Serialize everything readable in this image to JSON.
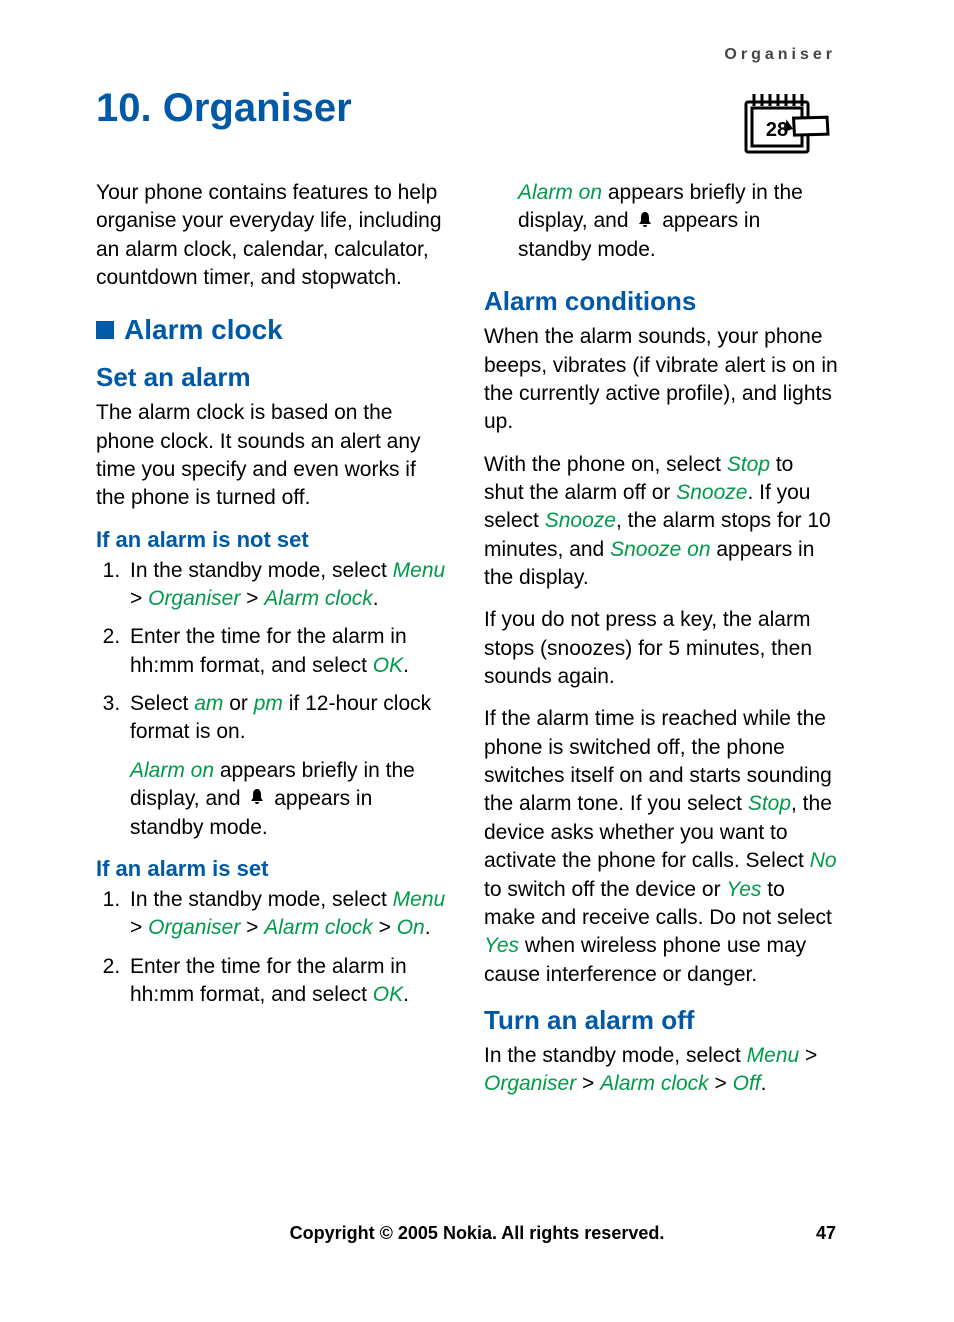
{
  "running_head": "Organiser",
  "chapter_title": "10. Organiser",
  "intro": "Your phone contains features to help organise your everyday life, including an alarm clock, calendar, calculator, countdown timer, and stopwatch.",
  "h2_alarm_clock": "Alarm clock",
  "h3_set_alarm": "Set an alarm",
  "set_alarm_p": "The alarm clock is based on the phone clock. It sounds an alert any time you specify and even works if the phone is turned off.",
  "h4_not_set": "If an alarm is not set",
  "not_set_step1_a": "In the standby mode, select ",
  "term_menu": "Menu",
  "gt": " > ",
  "term_organiser": "Organiser",
  "term_alarm_clock": "Alarm clock",
  "period": ".",
  "not_set_step2_a": "Enter the time for the alarm in hh:mm format, and select ",
  "term_ok": "OK",
  "not_set_step3_a": "Select ",
  "term_am": "am",
  "or": " or ",
  "term_pm": "pm",
  "not_set_step3_b": " if 12-hour clock format is on.",
  "alarm_on_note_a": "Alarm on",
  "alarm_on_note_b": " appears briefly in the display, and ",
  "alarm_on_note_c": " appears in standby mode.",
  "h4_is_set": "If an alarm is set",
  "is_set_step1_a": "In the standby mode, select ",
  "term_on": "On",
  "is_set_step2_a": "Enter the time for the alarm in hh:mm format, and select ",
  "h3_alarm_conditions": "Alarm conditions",
  "cond_p1": "When the alarm sounds, your phone beeps, vibrates (if vibrate alert is on in the currently active profile), and lights up.",
  "cond_p2_a": "With the phone on, select ",
  "term_stop": "Stop",
  "cond_p2_b": " to shut the alarm off or ",
  "term_snooze": "Snooze",
  "cond_p2_c": ". If you select ",
  "cond_p2_d": ", the alarm stops for 10 minutes, and ",
  "term_snooze_on": "Snooze on",
  "cond_p2_e": " appears in the display.",
  "cond_p3": "If you do not press a key, the alarm stops (snoozes) for 5 minutes, then sounds again.",
  "cond_p4_a": "If the alarm time is reached while the phone is switched off, the phone switches itself on and starts sounding the alarm tone. If you select ",
  "cond_p4_b": ", the device asks whether you want to activate the phone for calls. Select ",
  "term_no": "No",
  "cond_p4_c": " to switch off the device or ",
  "term_yes": "Yes",
  "cond_p4_d": " to make and receive calls. Do not select ",
  "cond_p4_e": " when wireless phone use may cause interference or danger.",
  "h3_turn_off": "Turn an alarm off",
  "turn_off_a": "In the standby mode, select ",
  "term_off": "Off",
  "footer": "Copyright © 2005 Nokia. All rights reserved.",
  "page_number": "47"
}
